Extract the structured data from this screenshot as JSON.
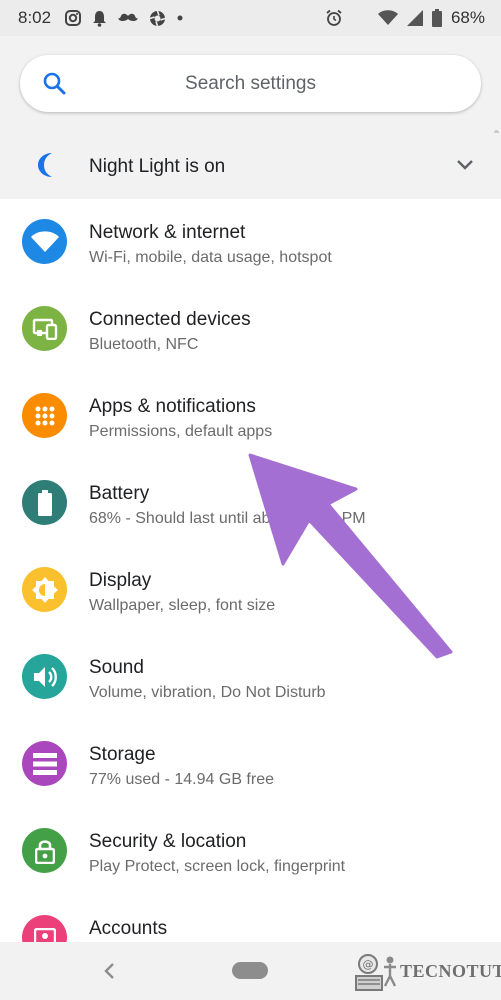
{
  "status_bar": {
    "time": "8:02",
    "battery_percent": "68%",
    "notification_icons": [
      "instagram-icon",
      "bell-icon",
      "mustache-icon",
      "aperture-icon",
      "dot-icon"
    ],
    "system_icons": [
      "alarm-icon",
      "wifi-icon",
      "signal-icon",
      "battery-icon"
    ]
  },
  "search": {
    "placeholder": "Search settings"
  },
  "night_light": {
    "label": "Night Light is on"
  },
  "settings": [
    {
      "title": "Network & internet",
      "subtitle": "Wi-Fi, mobile, data usage, hotspot",
      "icon": "wifi-icon",
      "color": "#1e88e5"
    },
    {
      "title": "Connected devices",
      "subtitle": "Bluetooth, NFC",
      "icon": "devices-icon",
      "color": "#7cb342"
    },
    {
      "title": "Apps & notifications",
      "subtitle": "Permissions, default apps",
      "icon": "apps-grid-icon",
      "color": "#fb8c00"
    },
    {
      "title": "Battery",
      "subtitle": "68% - Should last until about 10:30 PM",
      "icon": "battery-icon",
      "color": "#2e7d76"
    },
    {
      "title": "Display",
      "subtitle": "Wallpaper, sleep, font size",
      "icon": "brightness-icon",
      "color": "#fbc02d"
    },
    {
      "title": "Sound",
      "subtitle": "Volume, vibration, Do Not Disturb",
      "icon": "volume-icon",
      "color": "#26a69a"
    },
    {
      "title": "Storage",
      "subtitle": "77% used - 14.94 GB free",
      "icon": "storage-icon",
      "color": "#ab47bc"
    },
    {
      "title": "Security & location",
      "subtitle": "Play Protect, screen lock, fingerprint",
      "icon": "lock-icon",
      "color": "#43a047"
    },
    {
      "title": "Accounts",
      "subtitle": "",
      "icon": "account-icon",
      "color": "#ec407a"
    }
  ],
  "colors": {
    "accent": "#1a73e8",
    "arrow": "#a46fd2"
  },
  "watermark": {
    "text": "TECNOTUTO"
  }
}
